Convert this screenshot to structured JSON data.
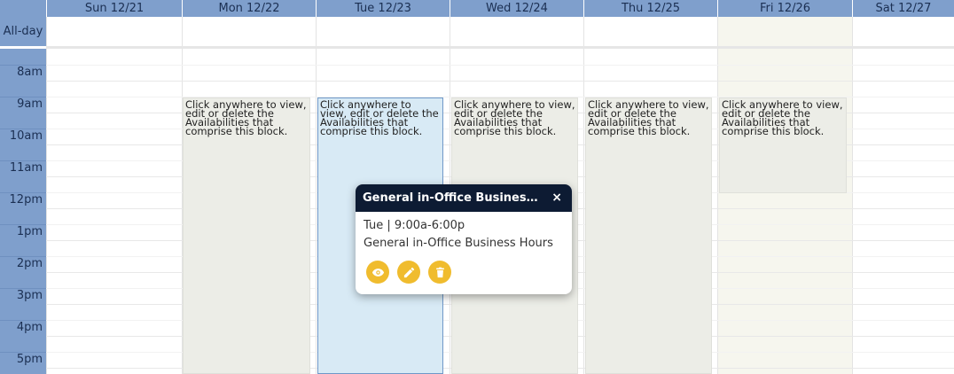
{
  "header": {
    "days": [
      "Sun 12/21",
      "Mon 12/22",
      "Tue 12/23",
      "Wed 12/24",
      "Thu 12/25",
      "Fri 12/26",
      "Sat 12/27"
    ]
  },
  "allday": {
    "label": "All-day"
  },
  "hours": [
    "8am",
    "9am",
    "10am",
    "11am",
    "12pm",
    "1pm",
    "2pm",
    "3pm",
    "4pm",
    "5pm"
  ],
  "events": {
    "text": "Click anywhere to view, edit or delete the Availabilities that comprise this block."
  },
  "popup": {
    "title": "General in-Office Business Ho...",
    "close": "×",
    "time": "Tue | 9:00a-6:00p",
    "name": "General in-Office Business Hours",
    "icons": {
      "view": "eye-icon",
      "edit": "pencil-icon",
      "delete": "trash-icon"
    }
  },
  "colors": {
    "gutter": "#7f9fcc",
    "accent": "#f0bc2e",
    "popup_header": "#0d1b33",
    "selected_event": "#d8eaf5"
  }
}
